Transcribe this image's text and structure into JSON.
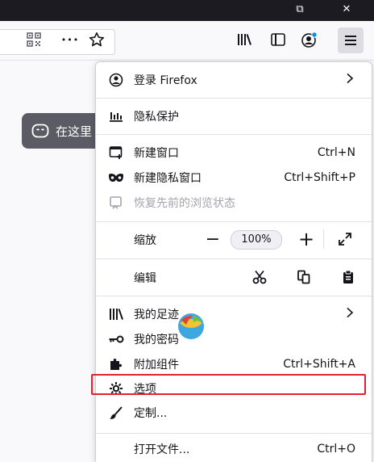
{
  "titlebar": {
    "restore_glyph": "⧉",
    "close_glyph": "✕"
  },
  "toolbar": {
    "overflow_glyph": "•••"
  },
  "content": {
    "pill_text": "在这里"
  },
  "menu": {
    "signin": {
      "label": "登录 Firefox"
    },
    "privacy": {
      "label": "隐私保护"
    },
    "new_window": {
      "label": "新建窗口",
      "shortcut": "Ctrl+N"
    },
    "new_private_window": {
      "label": "新建隐私窗口",
      "shortcut": "Ctrl+Shift+P"
    },
    "restore_session": {
      "label": "恢复先前的浏览状态"
    },
    "zoom": {
      "label": "缩放",
      "value": "100%",
      "minus": "−",
      "plus": "+"
    },
    "edit": {
      "label": "编辑"
    },
    "library": {
      "label": "我的足迹"
    },
    "logins": {
      "label": "我的密码"
    },
    "addons": {
      "label": "附加组件",
      "shortcut": "Ctrl+Shift+A"
    },
    "options": {
      "label": "选项"
    },
    "customize": {
      "label": "定制..."
    },
    "open_file": {
      "label": "打开文件...",
      "shortcut": "Ctrl+O"
    }
  },
  "colors": {
    "highlight_border": "#e0242f",
    "accent_dot": "#0090ed"
  }
}
